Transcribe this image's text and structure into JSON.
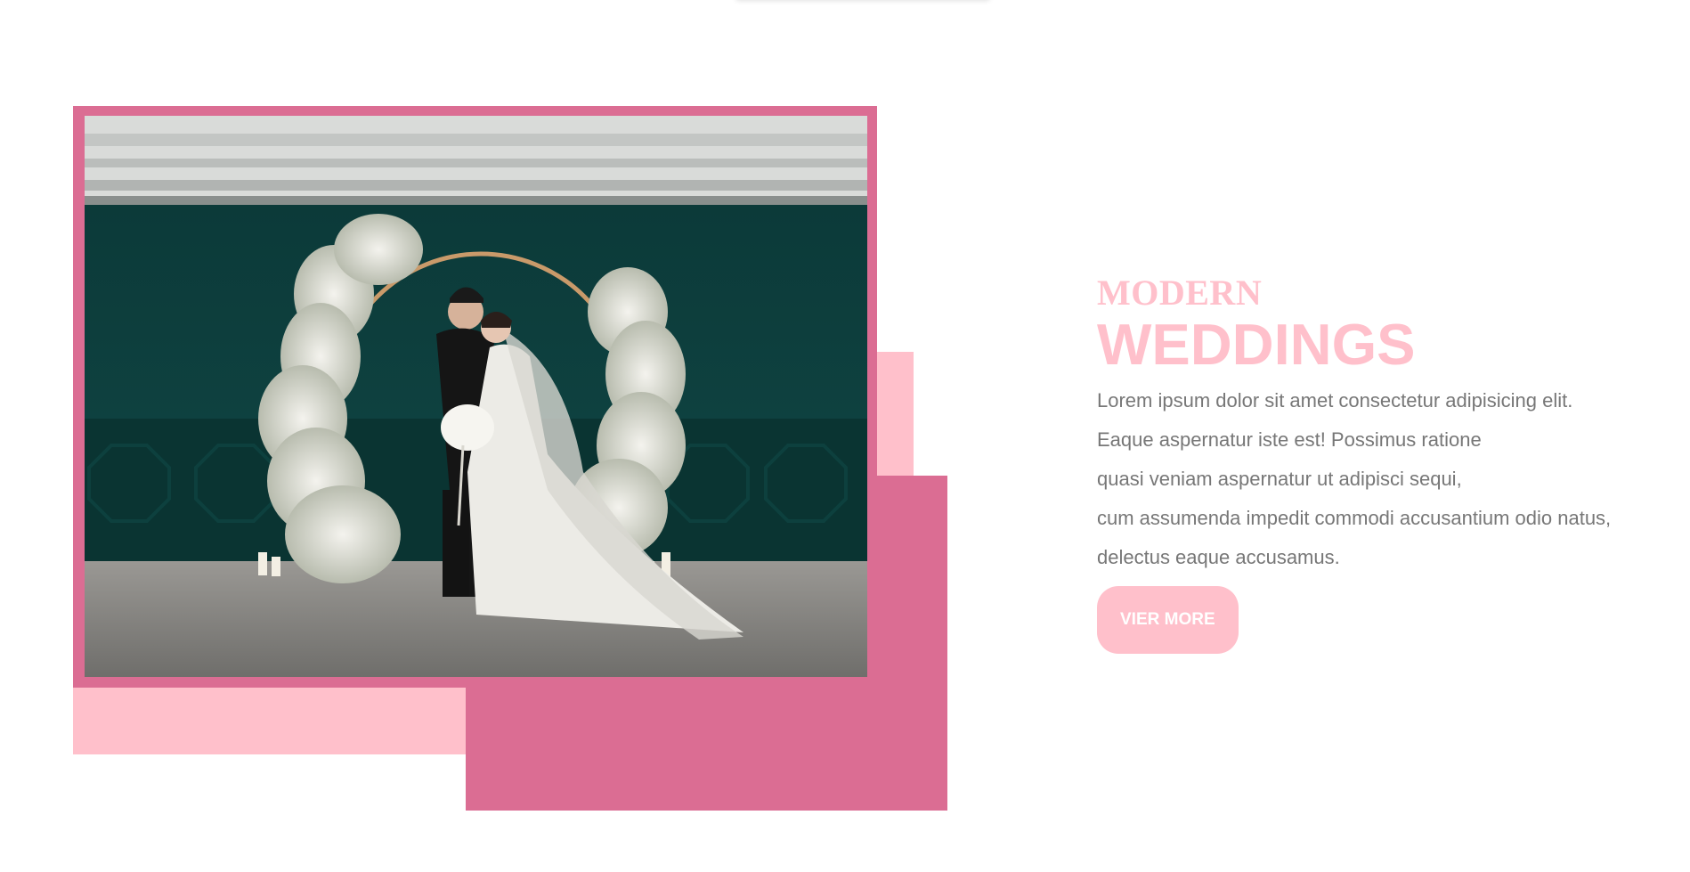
{
  "hero": {
    "kicker": "MODERN",
    "headline": "WEDDINGS",
    "body_lines": [
      "Lorem ipsum dolor sit amet consectetur adipisicing elit.",
      "Eaque aspernatur iste est! Possimus ratione",
      "quasi veniam aspernatur ut adipisci sequi,",
      "cum assumenda impedit commodi accusantium odio natus,",
      "delectus eaque accusamus."
    ],
    "cta_label": "VIER MORE"
  },
  "colors": {
    "accent_dark": "#db6d93",
    "accent_light": "#ffc0cb",
    "body_text": "#777777"
  },
  "photo": {
    "icon": "wedding-photo-image"
  }
}
